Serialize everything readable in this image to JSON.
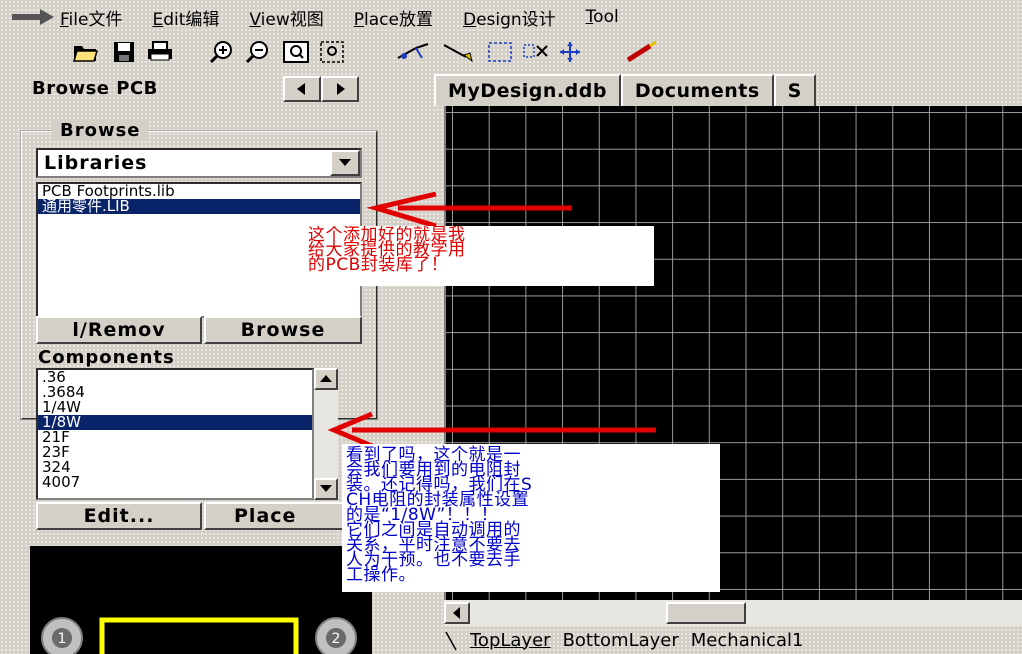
{
  "menu": {
    "items": [
      {
        "key": "F",
        "label": "ile文件"
      },
      {
        "key": "E",
        "label": "dit编辑"
      },
      {
        "key": "V",
        "label": "iew视图"
      },
      {
        "key": "P",
        "label": "lace放置"
      },
      {
        "key": "D",
        "label": "esign设计"
      },
      {
        "key": "T",
        "label": "ool"
      }
    ]
  },
  "toolbar": {
    "icons": [
      "open-folder-icon",
      "save-icon",
      "print-icon",
      "zoom-in-icon",
      "zoom-out-icon",
      "zoom-area-icon",
      "zoom-fit-icon",
      "cross-probe-icon",
      "wire-icon",
      "select-area-icon",
      "deselect-icon",
      "move-icon",
      "tool-icon"
    ]
  },
  "left_panel": {
    "title": "Browse PCB",
    "browse_group_label": "Browse",
    "browse_mode": "Libraries",
    "libraries": [
      "PCB Footprints.lib",
      "通用零件.LIB"
    ],
    "selected_library_index": 1,
    "remove_button": "l/Remov",
    "browse_button": "Browse",
    "components_label": "Components",
    "components": [
      ".36",
      ".3684",
      "1/4W",
      "1/8W",
      "21F",
      "23F",
      "324",
      "4007"
    ],
    "selected_component_index": 3,
    "edit_button": "Edit...",
    "place_button": "Place",
    "preview_pads": [
      "1",
      "2"
    ]
  },
  "right_pane": {
    "tabs": [
      "MyDesign.ddb",
      "Documents",
      "S"
    ],
    "layer_tabs": [
      "TopLayer",
      "BottomLayer",
      "Mechanical1"
    ]
  },
  "annotations": {
    "note1": [
      "这个添加好的就是我",
      "给大家提供的教学用",
      "的PCB封装库了！"
    ],
    "note2": [
      "看到了吗，这个就是一",
      "会我们要用到的电阻封",
      "装。还记得吗，我们在S",
      "CH电阻的封装属性设置",
      "的是“1/8W”！！！",
      "它们之间是自动调用的",
      "关系，平时注意不要去",
      "人为干预。也不要去手",
      "工操作。"
    ]
  },
  "colors": {
    "annotation_red": "#e00000",
    "annotation_blue": "#0000cc",
    "selection": "#0a246a",
    "footprint_outline": "#ffff00"
  }
}
